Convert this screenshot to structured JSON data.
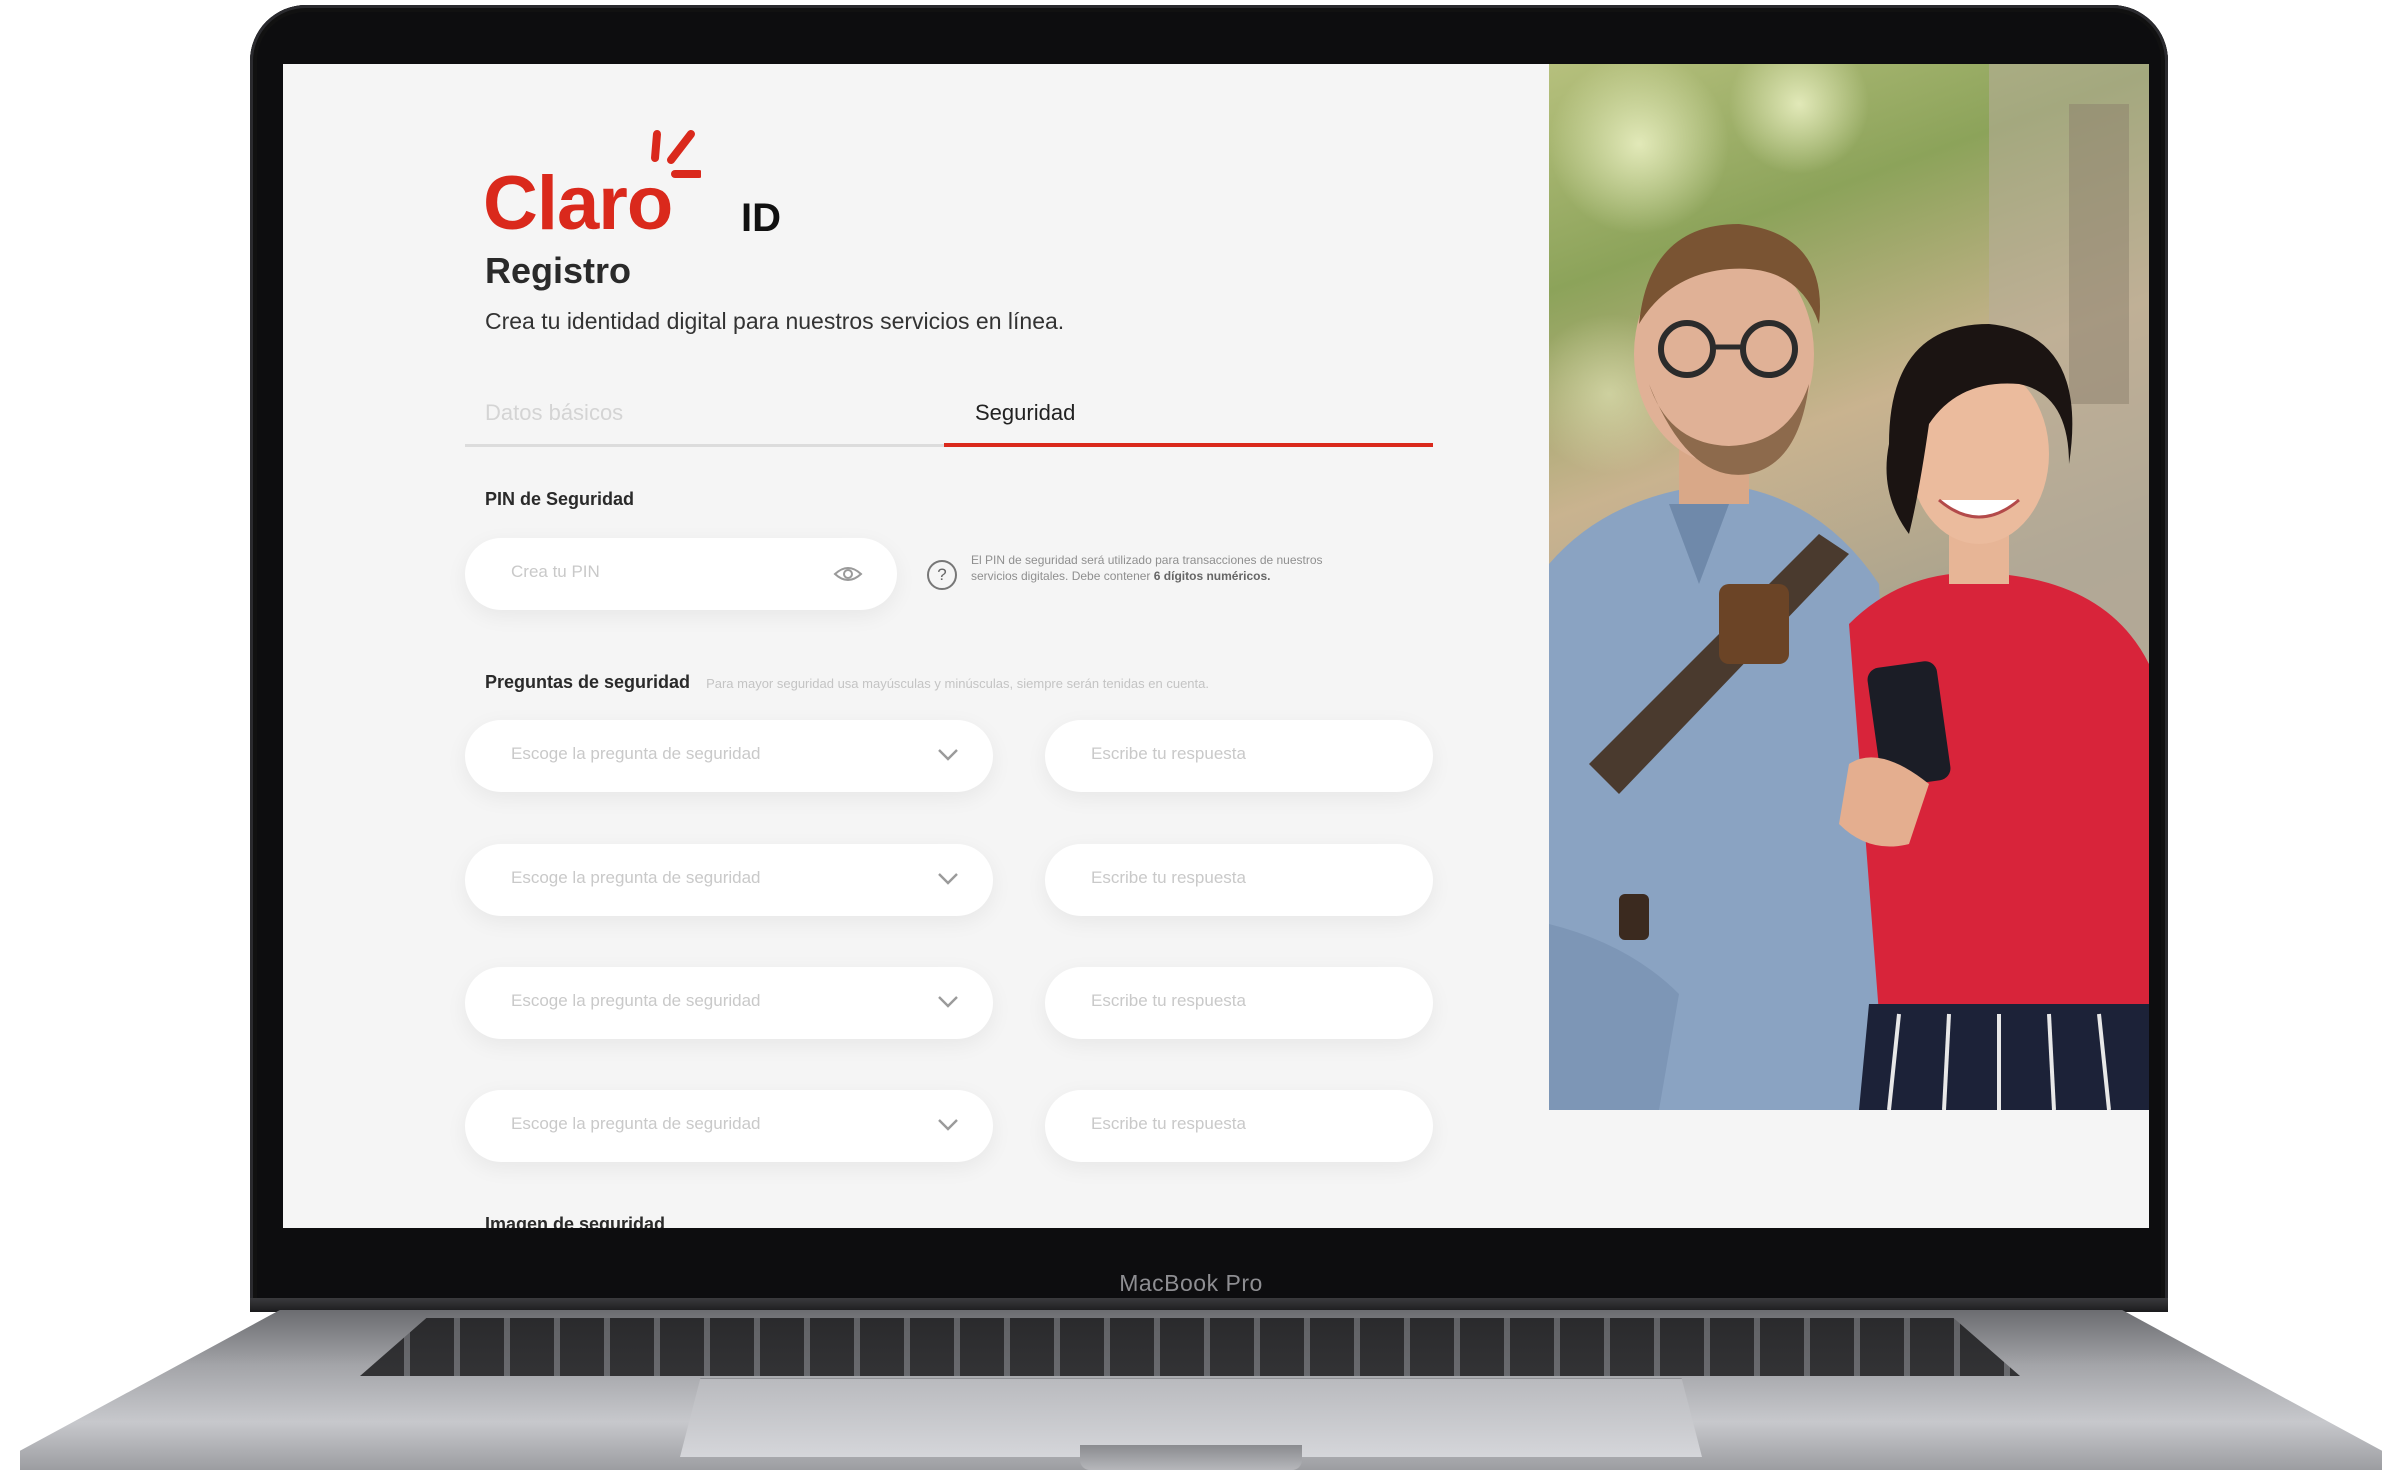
{
  "device": {
    "model_label": "MacBook Pro"
  },
  "brand": {
    "name": "Claro",
    "suffix": "ID",
    "accent": "#da291c"
  },
  "page": {
    "title": "Registro",
    "subtitle": "Crea tu identidad digital para nuestros servicios en línea."
  },
  "tabs": [
    {
      "label": "Datos básicos",
      "active": false
    },
    {
      "label": "Seguridad",
      "active": true
    }
  ],
  "pin": {
    "label": "PIN de Seguridad",
    "placeholder": "Crea tu PIN",
    "eye_icon": "eye-icon",
    "help_icon": "question-circle-icon",
    "help_text": "El PIN de seguridad será utilizado para transacciones de nuestros servicios digitales. Debe contener",
    "help_emphasis": "6 dígitos numéricos."
  },
  "questions": {
    "label": "Preguntas de seguridad",
    "hint": "Para mayor seguridad usa mayúsculas y minúsculas, siempre serán tenidas en cuenta.",
    "rows": [
      {
        "question_placeholder": "Escoge la pregunta de seguridad",
        "answer_placeholder": "Escribe tu respuesta"
      },
      {
        "question_placeholder": "Escoge la pregunta de seguridad",
        "answer_placeholder": "Escribe tu respuesta"
      },
      {
        "question_placeholder": "Escoge la pregunta de seguridad",
        "answer_placeholder": "Escribe tu respuesta"
      },
      {
        "question_placeholder": "Escoge la pregunta de seguridad",
        "answer_placeholder": "Escribe tu respuesta"
      }
    ]
  },
  "image_section": {
    "label": "Imagen de seguridad"
  }
}
